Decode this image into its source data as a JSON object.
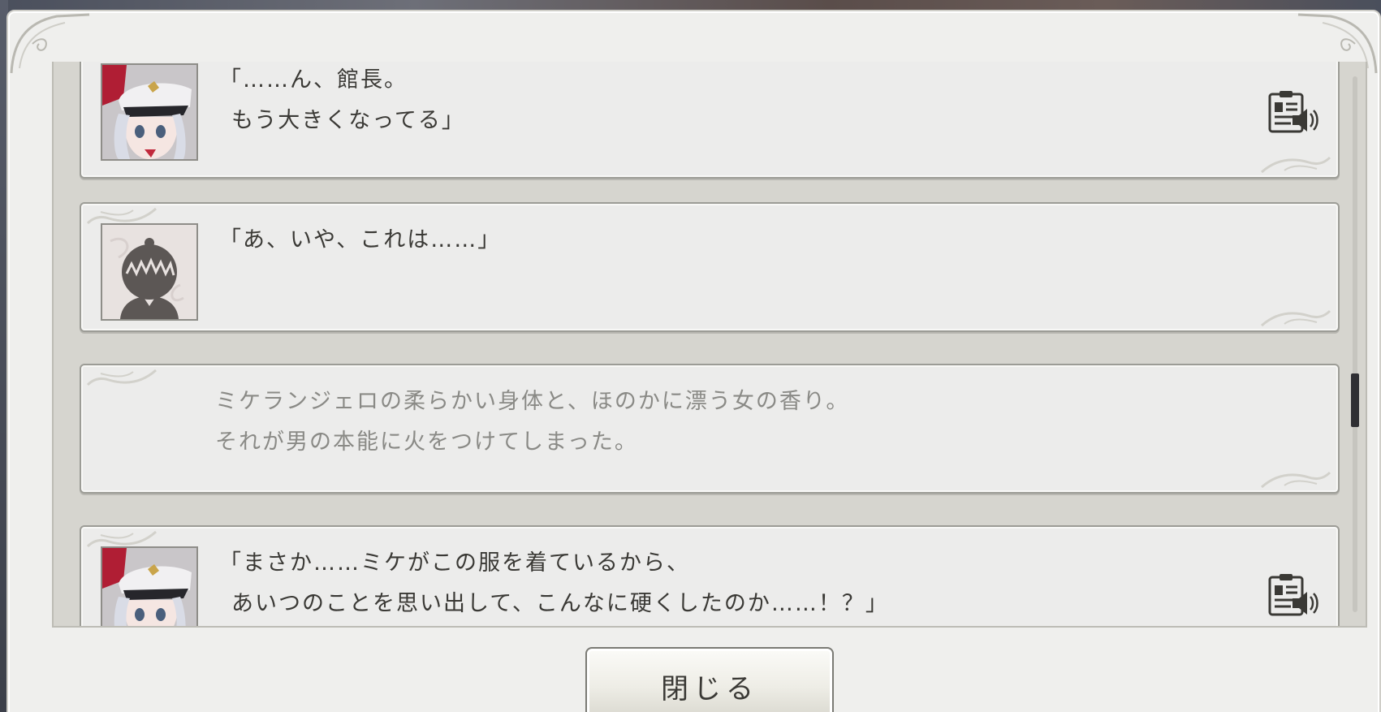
{
  "log": [
    {
      "speaker": "character",
      "lines": [
        "「……ん、館長。",
        "もう大きくなってる」"
      ],
      "voice": true
    },
    {
      "speaker": "player",
      "lines": [
        "「あ、いや、これは……」"
      ],
      "voice": false
    },
    {
      "speaker": "narration",
      "lines": [
        "ミケランジェロの柔らかい身体と、ほのかに漂う女の香り。",
        "それが男の本能に火をつけてしまった。"
      ],
      "voice": false
    },
    {
      "speaker": "character",
      "lines": [
        "「まさか……ミケがこの服を着ているから、",
        "あいつのことを思い出して、こんなに硬くしたのか……！？」"
      ],
      "voice": true
    }
  ],
  "close_button": {
    "label": "閉じる"
  },
  "scrollbar": {
    "position": 0.58
  },
  "colors": {
    "panel": "#efefed",
    "card": "#ececeb",
    "text": "#3a3935",
    "narration": "#8a8a86",
    "thumb": "#2f2f33"
  }
}
